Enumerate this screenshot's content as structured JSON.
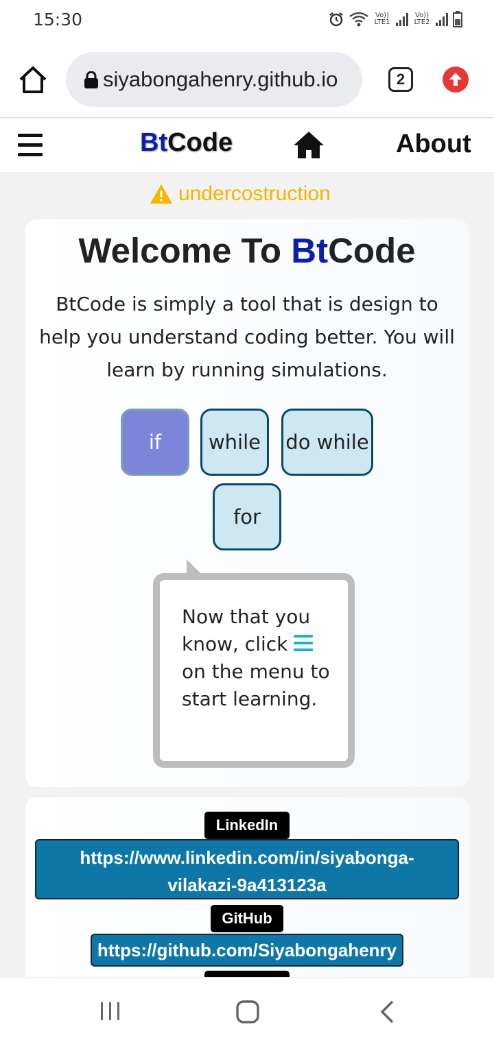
{
  "status_bar": {
    "time": "15:30",
    "network_1": "Vo)) LTE1",
    "network_2": "Vo)) LTE2",
    "icons": [
      "alarm-icon",
      "wifi-icon",
      "signal-icon",
      "battery-icon"
    ]
  },
  "browser": {
    "url": "siyabongahenry.github.io",
    "tab_count": "2",
    "icons": [
      "home-icon",
      "lock-icon",
      "update-arrow-icon"
    ]
  },
  "navbar": {
    "brand_prefix": "Bt",
    "brand_suffix": "Code",
    "about_label": "About",
    "icons": [
      "hamburger-menu-icon",
      "house-icon"
    ]
  },
  "warning": {
    "text": "undercostruction",
    "icon": "warning-triangle-icon"
  },
  "welcome": {
    "title_prefix": "Welcome To ",
    "title_brand_prefix": "Bt",
    "title_brand_suffix": "Code",
    "description": "BtCode is simply a tool that is design to help you understand coding better. You will learn by running simulations."
  },
  "loops": [
    {
      "label": "if",
      "active": true
    },
    {
      "label": "while",
      "active": false
    },
    {
      "label": "do while",
      "active": false
    },
    {
      "label": "for",
      "active": false
    }
  ],
  "bubble": {
    "text_before": "Now that you know, click",
    "text_after": "on the menu to start learning."
  },
  "links": {
    "linkedin_tag": "LinkedIn",
    "linkedin_url_line1": "https://www.linkedin.com/in/siyabonga-",
    "linkedin_url_line2": "vilakazi-9a413123a",
    "github_tag": "GitHub",
    "github_url": "https://github.com/Siyabongahenry"
  },
  "colors": {
    "brand_blue": "#0d1fa8",
    "warning_yellow": "#f4b400",
    "active_button": "#7b86db",
    "inactive_button": "#cde8f2",
    "link_blue": "#0f77a8",
    "menu_cyan": "#1bb3cc"
  }
}
